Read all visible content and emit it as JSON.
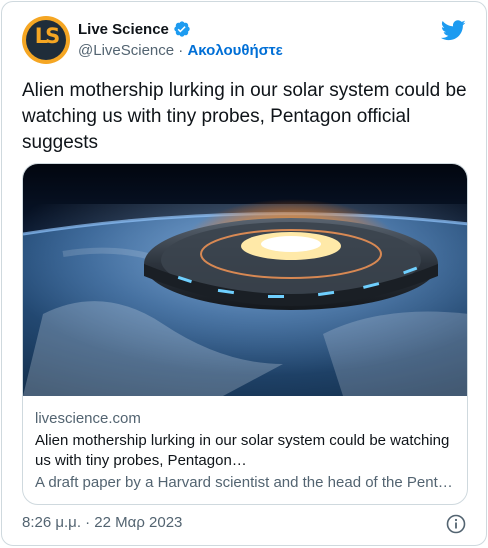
{
  "author": {
    "avatar_text": "LS",
    "display_name": "Live Science",
    "handle": "@LiveScience",
    "separator": " · ",
    "follow_label": "Ακολουθήστε",
    "verified": true
  },
  "tweet": {
    "text": "Alien mothership lurking in our solar system could be watching us with tiny probes, Pentagon official suggests"
  },
  "card": {
    "domain": "livescience.com",
    "title": "Alien mothership lurking in our solar system could be watching us with tiny probes, Pentagon…",
    "description": "A draft paper by a Harvard scientist and the head of the Pent…",
    "image_subject": "UFO mothership hovering over Earth at sunrise"
  },
  "footer": {
    "timestamp": "8:26 μ.μ. · 22 Μαρ 2023"
  },
  "icons": {
    "brand": "twitter-bird-icon",
    "verified": "verified-badge-icon",
    "info": "info-icon"
  },
  "colors": {
    "twitter_blue": "#1d9bf0",
    "follow_link": "#006fd6",
    "secondary_text": "#536471"
  }
}
